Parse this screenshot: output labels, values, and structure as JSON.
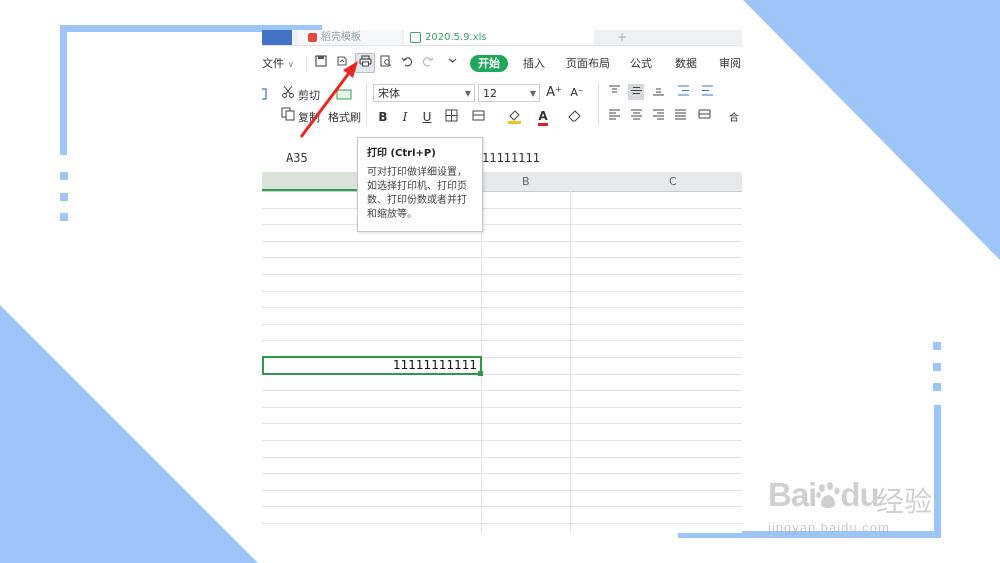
{
  "tabs": {
    "doc_title": "稻壳模板",
    "book_title": "2020.5.9.xls",
    "plus": "+"
  },
  "menubar": {
    "file": "文件",
    "file_arrow": "∨",
    "start": "开始",
    "insert": "插入",
    "page_layout": "页面布局",
    "formula": "公式",
    "data": "数据",
    "review": "审阅"
  },
  "ribbon": {
    "cut": "剪切",
    "copy": "复制",
    "format_painter": "格式刷",
    "font_name": "宋体",
    "font_size": "12",
    "bold": "B",
    "italic": "I",
    "underline": "U",
    "font_color_label": "A",
    "grow_font": "A⁺",
    "shrink_font": "A⁻",
    "merge": "合"
  },
  "formula_bar": {
    "name_box": "A35",
    "content": "11111111"
  },
  "columns": {
    "b": "B",
    "c": "C"
  },
  "active_cell": {
    "value": "11111111111"
  },
  "tooltip": {
    "title": "打印 (Ctrl+P)",
    "line1": "可对打印做详细设置，",
    "line2": "如选择打印机、打印页",
    "line3": "数、打印份数或者并打",
    "line4": "和缩放等。"
  },
  "watermark": {
    "brand": "Bai",
    "brand2": "du",
    "suffix": "经验",
    "url": "jingyan.baidu.com"
  },
  "colors": {
    "frame_blue": "#9ec5f8",
    "start_green": "#1ea85a",
    "active_green": "#2f9a45",
    "arrow_red": "#e8281e"
  }
}
